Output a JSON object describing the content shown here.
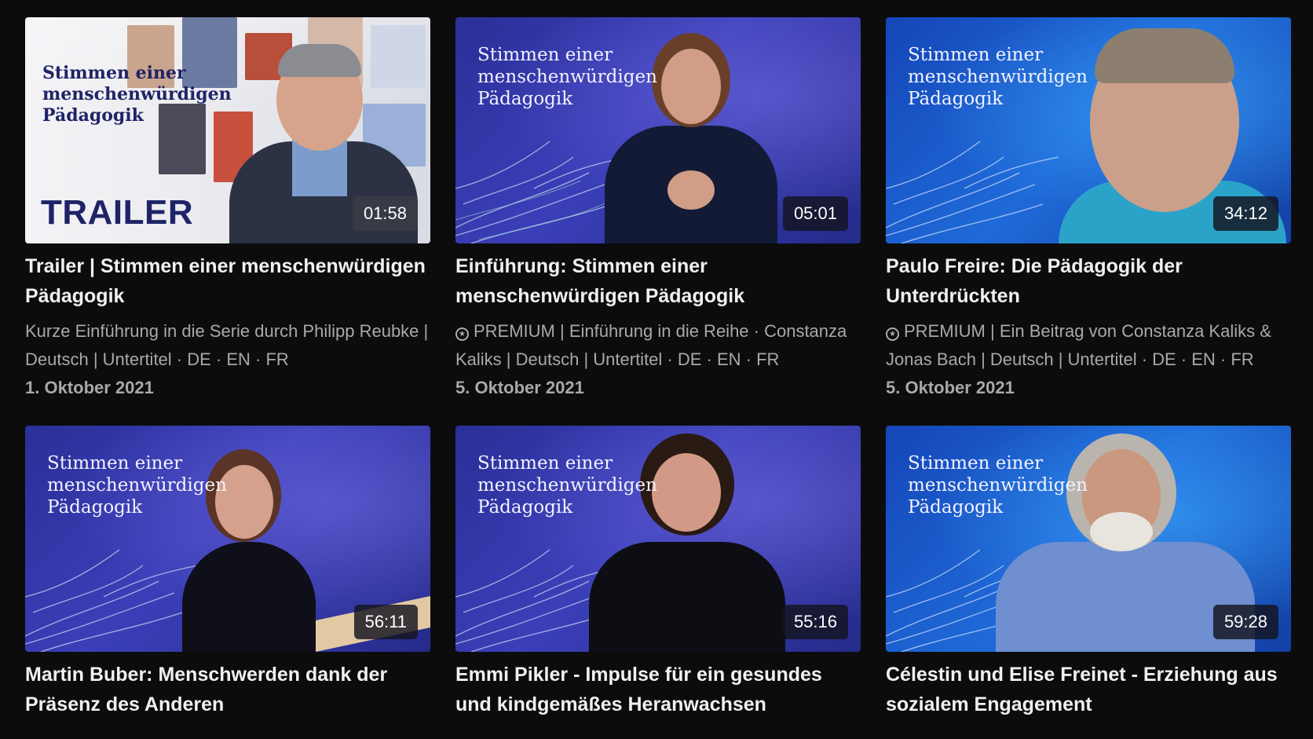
{
  "series_overlay": "Stimmen einer\nmenschenwürdigen\nPädagogik",
  "trailer_badge": "TRAILER",
  "videos": [
    {
      "thumb_style": "light",
      "duration": "01:58",
      "title": "Trailer | Stimmen einer menschenwürdigen Pädagogik",
      "premium": false,
      "description": "Kurze Einführung in die Serie durch Philipp Reubke | Deutsch | Untertitel · DE · EN · FR",
      "date": "1. Oktober 2021"
    },
    {
      "thumb_style": "blue",
      "duration": "05:01",
      "title": "Einführung: Stimmen einer menschenwürdigen Pädagogik",
      "premium": true,
      "description": "PREMIUM | Einführung in die Reihe · Constanza Kaliks | Deutsch | Untertitel · DE · EN · FR",
      "date": "5. Oktober 2021"
    },
    {
      "thumb_style": "cyan",
      "duration": "34:12",
      "title": "Paulo Freire: Die Pädagogik der Unterdrückten",
      "premium": true,
      "description": "PREMIUM | Ein Beitrag von Constanza Kaliks & Jonas Bach | Deutsch | Untertitel · DE · EN · FR",
      "date": "5. Oktober 2021"
    },
    {
      "thumb_style": "blue",
      "duration": "56:11",
      "title": "Martin Buber: Menschwerden dank der Präsenz des Anderen"
    },
    {
      "thumb_style": "blue",
      "duration": "55:16",
      "title": "Emmi Pikler - Impulse für ein gesundes und kindgemäßes Heranwachsen"
    },
    {
      "thumb_style": "blue",
      "duration": "59:28",
      "title": "Célestin und Elise Freinet - Erziehung aus sozialem Engagement"
    }
  ],
  "colors": {
    "background": "#0c0c0d",
    "thumb_blue": "#2b2f98",
    "thumb_cyan": "#1f6ad8",
    "overlay_navy": "#1f2366",
    "secondary_text": "#a9a9ad"
  },
  "icons": {
    "premium": "star-circle-icon"
  }
}
